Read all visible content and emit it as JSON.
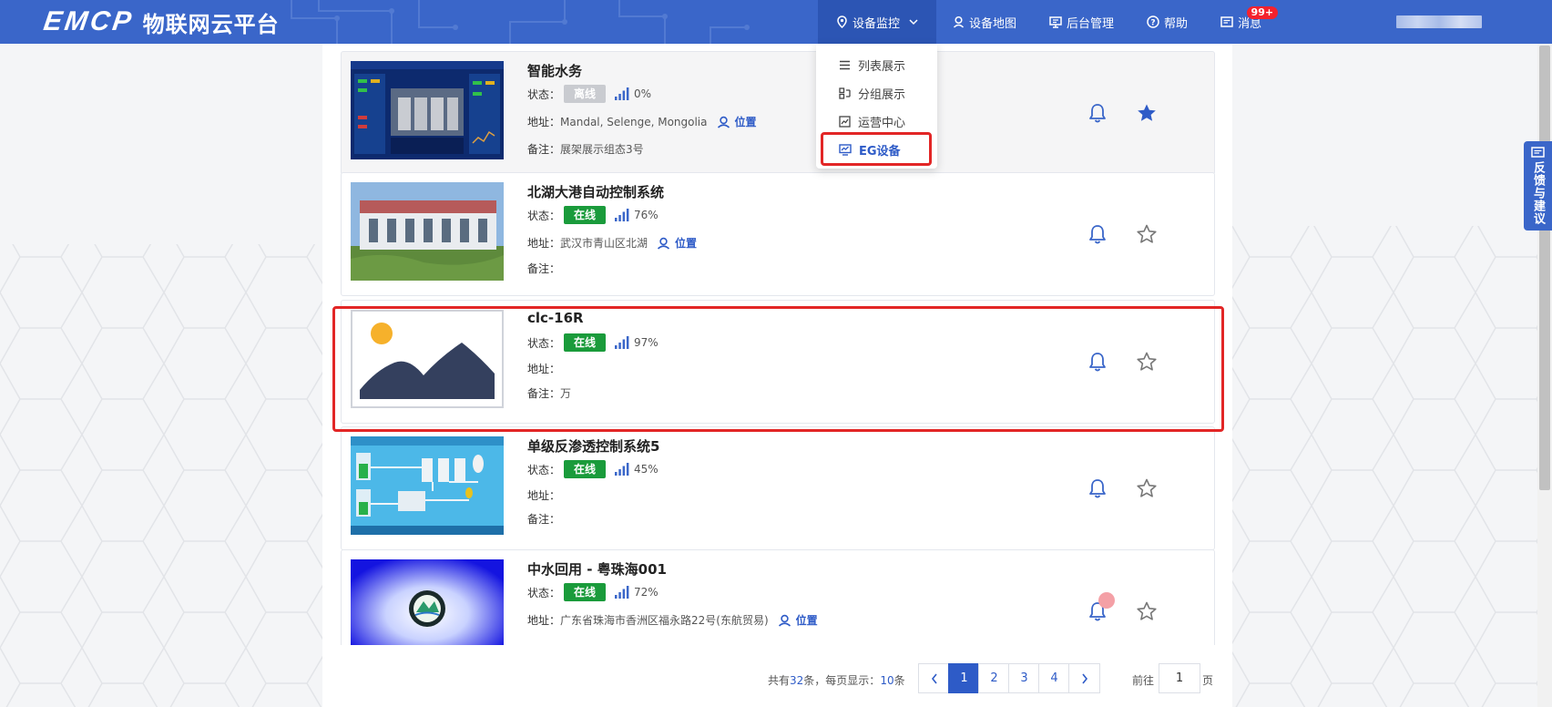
{
  "header": {
    "logo_mark": "EMCP",
    "logo_text": "物联网云平台",
    "nav": [
      {
        "label": "设备监控",
        "icon": "location-pin-icon"
      },
      {
        "label": "设备地图",
        "icon": "person-pin-icon"
      },
      {
        "label": "后台管理",
        "icon": "monitor-icon"
      },
      {
        "label": "帮助",
        "icon": "question-icon"
      },
      {
        "label": "消息",
        "icon": "message-icon",
        "badge": "99+"
      }
    ]
  },
  "dropdown": {
    "items": [
      {
        "label": "列表展示",
        "icon": "list-icon"
      },
      {
        "label": "分组展示",
        "icon": "group-icon"
      },
      {
        "label": "运营中心",
        "icon": "chart-box-icon"
      },
      {
        "label": "EG设备",
        "icon": "trend-monitor-icon",
        "active": true
      }
    ]
  },
  "labels": {
    "status": "状态：",
    "address": "地址：",
    "remark": "备注：",
    "location": "位置"
  },
  "devices": [
    {
      "name": "智能水务",
      "status": "离线",
      "online": false,
      "signal": "0%",
      "address": "Mandal, Selenge, Mongolia",
      "show_location": true,
      "remark": "展架展示组态3号",
      "favorite": true
    },
    {
      "name": "北湖大港自动控制系统",
      "status": "在线",
      "online": true,
      "signal": "76%",
      "address": "武汉市青山区北湖",
      "show_location": true,
      "remark": "",
      "favorite": false
    },
    {
      "name": "clc-16R",
      "status": "在线",
      "online": true,
      "signal": "97%",
      "address": "",
      "show_location": false,
      "remark": "万",
      "favorite": false
    },
    {
      "name": "单级反渗透控制系统5",
      "status": "在线",
      "online": true,
      "signal": "45%",
      "address": "",
      "show_location": false,
      "remark": "",
      "favorite": false
    },
    {
      "name": "中水回用 - 粤珠海001",
      "status": "在线",
      "online": true,
      "signal": "72%",
      "address": "广东省珠海市香洲区福永路22号(东航贸易)",
      "show_location": true,
      "remark": "",
      "favorite": false
    }
  ],
  "pagination": {
    "total_prefix": "共有",
    "total": "32",
    "total_mid": "条，每页显示：",
    "page_size": "10",
    "page_size_suffix": "条",
    "pages": [
      "1",
      "2",
      "3",
      "4"
    ],
    "current": "1",
    "goto_prefix": "前往",
    "goto_value": "1",
    "goto_suffix": "页"
  },
  "feedback": {
    "label": "反馈与建议"
  },
  "colors": {
    "primary": "#3a66c9",
    "online": "#1a9b3b",
    "offline": "#c9cbd0",
    "highlight": "#e22626"
  }
}
